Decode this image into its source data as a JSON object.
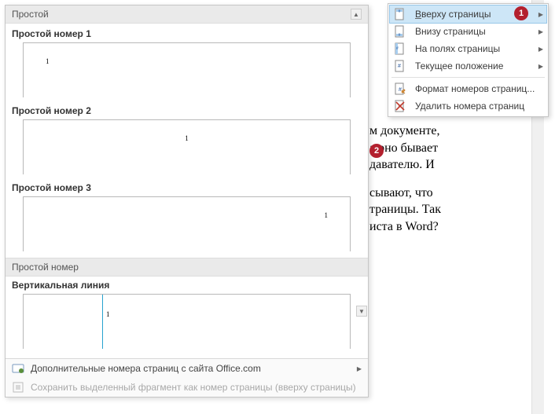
{
  "gallery": {
    "header": "Простой",
    "items": [
      {
        "label": "Простой номер 1",
        "num": "1",
        "pos": "left"
      },
      {
        "label": "Простой номер 2",
        "num": "1",
        "pos": "center"
      },
      {
        "label": "Простой номер 3",
        "num": "1",
        "pos": "right"
      }
    ],
    "section2": "Простой номер",
    "item4_label": "Вертикальная линия",
    "item4_num": "1",
    "footer_more": "Дополнительные номера страниц с сайта Office.com",
    "footer_save": "Сохранить выделенный фрагмент как номер страницы (вверху страницы)"
  },
  "menu": {
    "top": "Вверху страницы",
    "bottom": "Внизу страницы",
    "margins": "На полях страницы",
    "current": "Текущее положение",
    "format": "Формат номеров страниц...",
    "remove": "Удалить номера страниц"
  },
  "badges": {
    "one": "1",
    "two": "2"
  },
  "doc": {
    "p1a": "м документе,",
    "p1b": "а оно бывает",
    "p1c": "давателю. И",
    "p2a": "сывают, что",
    "p2b": "траницы. Так",
    "p2c": "иста в Word?"
  }
}
